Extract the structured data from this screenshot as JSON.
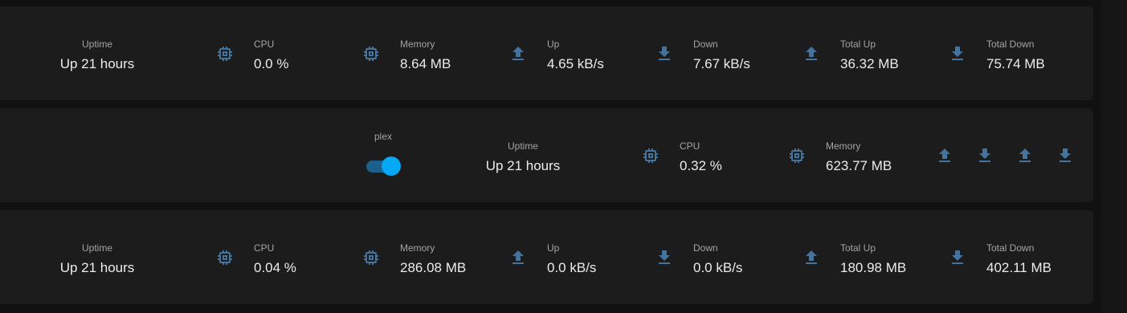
{
  "colors": {
    "icon": "#44739e",
    "toggle_on": "#03a9f4",
    "card_bg": "#1c1c1c"
  },
  "rows": [
    {
      "stats": [
        {
          "label": "Uptime",
          "value": "Up 21 hours",
          "icon": null
        },
        {
          "label": "CPU",
          "value": "0.0 %",
          "icon": "cpu-icon"
        },
        {
          "label": "Memory",
          "value": "8.64 MB",
          "icon": "memory-icon"
        },
        {
          "label": "Up",
          "value": "4.65 kB/s",
          "icon": "upload-icon"
        },
        {
          "label": "Down",
          "value": "7.67 kB/s",
          "icon": "download-icon"
        },
        {
          "label": "Total Up",
          "value": "36.32 MB",
          "icon": "upload-icon"
        },
        {
          "label": "Total Down",
          "value": "75.74 MB",
          "icon": "download-icon"
        }
      ]
    },
    {
      "switch": {
        "label": "plex",
        "state": "on"
      },
      "stats": [
        {
          "label": "Uptime",
          "value": "Up 21 hours",
          "icon": null
        },
        {
          "label": "CPU",
          "value": "0.32 %",
          "icon": "cpu-icon"
        },
        {
          "label": "Memory",
          "value": "623.77 MB",
          "icon": "memory-icon"
        }
      ],
      "network_icons": [
        "upload-icon",
        "download-icon",
        "upload-icon",
        "download-icon"
      ]
    },
    {
      "stats": [
        {
          "label": "Uptime",
          "value": "Up 21 hours",
          "icon": null
        },
        {
          "label": "CPU",
          "value": "0.04 %",
          "icon": "cpu-icon"
        },
        {
          "label": "Memory",
          "value": "286.08 MB",
          "icon": "memory-icon"
        },
        {
          "label": "Up",
          "value": "0.0 kB/s",
          "icon": "upload-icon"
        },
        {
          "label": "Down",
          "value": "0.0 kB/s",
          "icon": "download-icon"
        },
        {
          "label": "Total Up",
          "value": "180.98 MB",
          "icon": "upload-icon"
        },
        {
          "label": "Total Down",
          "value": "402.11 MB",
          "icon": "download-icon"
        }
      ]
    }
  ]
}
